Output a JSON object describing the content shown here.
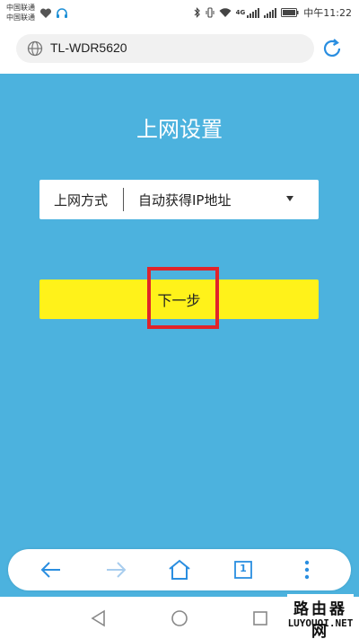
{
  "status_bar": {
    "carrier_line1": "中国联通",
    "carrier_line2": "中国联通",
    "network_label": "4G",
    "time": "中午11:22"
  },
  "address_bar": {
    "url": "TL-WDR5620"
  },
  "page": {
    "title": "上网设置",
    "connection_type": {
      "label": "上网方式",
      "value": "自动获得IP地址"
    },
    "next_button_label": "下一步"
  },
  "toolbar": {
    "tab_count": "1"
  },
  "watermark": {
    "line1": "路由器网",
    "line2": "LUYOUQI.NET"
  },
  "colors": {
    "page_background": "#4cb2de",
    "next_button": "#fff21a",
    "highlight": "#e0242a",
    "toolbar_icons": "#2a8ee0"
  }
}
